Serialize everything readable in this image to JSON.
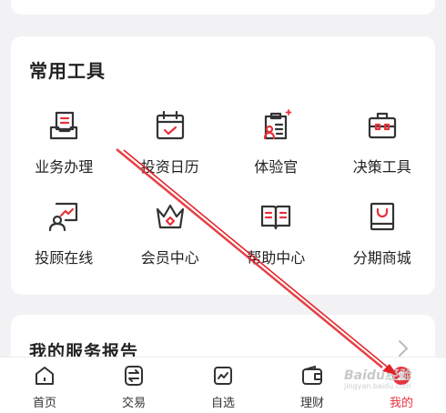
{
  "tools": {
    "title": "常用工具",
    "items": [
      {
        "label": "业务办理",
        "icon": "document-tray-icon"
      },
      {
        "label": "投资日历",
        "icon": "calendar-check-icon"
      },
      {
        "label": "体验官",
        "icon": "clipboard-user-icon"
      },
      {
        "label": "决策工具",
        "icon": "toolbox-icon"
      },
      {
        "label": "投顾在线",
        "icon": "chat-chart-icon"
      },
      {
        "label": "会员中心",
        "icon": "crown-icon"
      },
      {
        "label": "帮助中心",
        "icon": "open-book-icon"
      },
      {
        "label": "分期商城",
        "icon": "shopping-bag-icon"
      }
    ]
  },
  "service_report": {
    "title": "我的服务报告"
  },
  "tabbar": {
    "items": [
      {
        "label": "首页",
        "icon": "home-icon",
        "active": false
      },
      {
        "label": "交易",
        "icon": "trade-icon",
        "active": false
      },
      {
        "label": "自选",
        "icon": "chart-icon",
        "active": false
      },
      {
        "label": "理财",
        "icon": "wallet-icon",
        "active": false
      },
      {
        "label": "我的",
        "icon": "profile-icon",
        "active": true
      }
    ]
  },
  "watermark": {
    "brand": "Baidu经验",
    "url": "jingyan.baidu.com"
  },
  "colors": {
    "accent": "#e8323c",
    "icon": "#333333",
    "background": "#f2f2f4"
  }
}
